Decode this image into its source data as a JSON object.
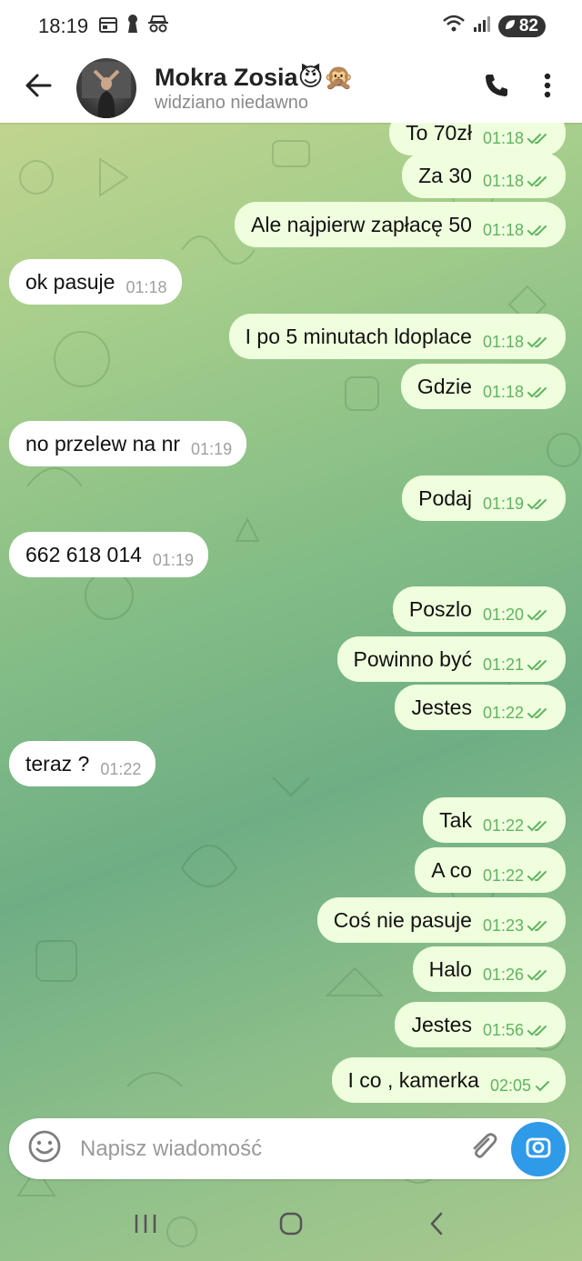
{
  "status_bar": {
    "time": "18:19",
    "battery": "82",
    "icons": [
      "calendar-icon",
      "keyhole-icon",
      "incognito-icon",
      "wifi-icon",
      "signal-icon"
    ]
  },
  "header": {
    "contact_name": "Mokra Zosia😈🙊",
    "contact_status": "widziano niedawno",
    "icons": [
      "back-arrow-icon",
      "phone-icon",
      "more-vertical-icon"
    ]
  },
  "messages": [
    {
      "dir": "out",
      "text": "To 70zł",
      "time": "01:18",
      "status": "read"
    },
    {
      "dir": "out",
      "text": "Za 30",
      "time": "01:18",
      "status": "read"
    },
    {
      "dir": "out",
      "text": "Ale najpierw zapłacę 50",
      "time": "01:18",
      "status": "read"
    },
    {
      "dir": "in",
      "text": "ok pasuje",
      "time": "01:18"
    },
    {
      "dir": "out",
      "text": "I po 5 minutach ldoplace",
      "time": "01:18",
      "status": "read"
    },
    {
      "dir": "out",
      "text": "Gdzie",
      "time": "01:18",
      "status": "read"
    },
    {
      "dir": "in",
      "text": "no przelew na nr",
      "time": "01:19"
    },
    {
      "dir": "out",
      "text": "Podaj",
      "time": "01:19",
      "status": "read"
    },
    {
      "dir": "in",
      "text": "662 618 014",
      "time": "01:19"
    },
    {
      "dir": "out",
      "text": "Poszlo",
      "time": "01:20",
      "status": "read"
    },
    {
      "dir": "out",
      "text": "Powinno być",
      "time": "01:21",
      "status": "read"
    },
    {
      "dir": "out",
      "text": "Jestes",
      "time": "01:22",
      "status": "read"
    },
    {
      "dir": "in",
      "text": "teraz ?",
      "time": "01:22"
    },
    {
      "dir": "out",
      "text": "Tak",
      "time": "01:22",
      "status": "read"
    },
    {
      "dir": "out",
      "text": "A co",
      "time": "01:22",
      "status": "read"
    },
    {
      "dir": "out",
      "text": "Coś nie pasuje",
      "time": "01:23",
      "status": "read"
    },
    {
      "dir": "out",
      "text": "Halo",
      "time": "01:26",
      "status": "read"
    },
    {
      "dir": "out",
      "text": "Jestes",
      "time": "01:56",
      "status": "read"
    },
    {
      "dir": "out",
      "text": "I co , kamerka",
      "time": "02:05",
      "status": "sent"
    }
  ],
  "composer": {
    "placeholder": "Napisz wiadomość",
    "icons": [
      "emoji-icon",
      "paperclip-icon",
      "camera-icon"
    ]
  },
  "nav_bar": {
    "icons": [
      "recent-apps-icon",
      "home-icon",
      "back-icon"
    ]
  },
  "colors": {
    "outgoing_bubble": "#effedd",
    "incoming_bubble": "#ffffff",
    "tick_green": "#5fb461",
    "camera_button": "#2f9ae8"
  }
}
